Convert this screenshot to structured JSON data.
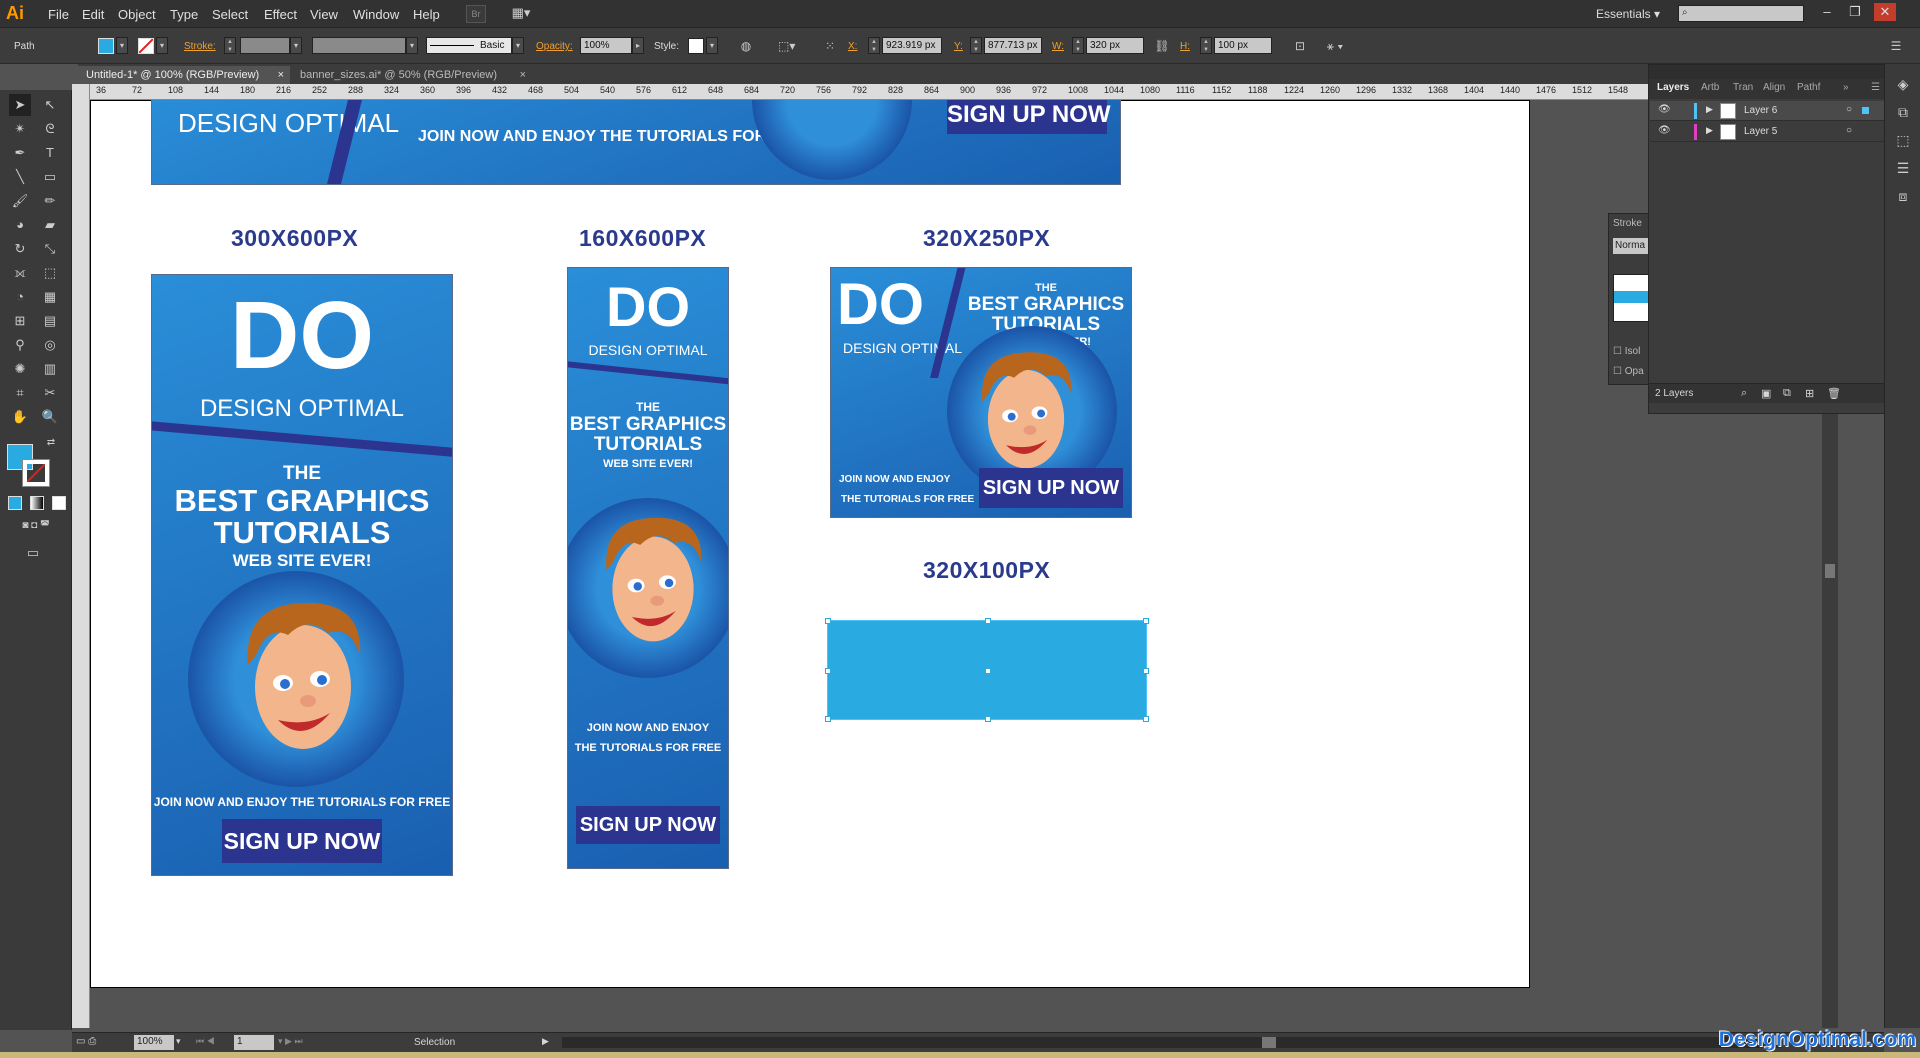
{
  "app": {
    "logo": "Ai",
    "workspace": "Essentials"
  },
  "menu": [
    "File",
    "Edit",
    "Object",
    "Type",
    "Select",
    "Effect",
    "View",
    "Window",
    "Help"
  ],
  "control": {
    "selection_type": "Path",
    "stroke_label": "Stroke:",
    "stroke_style": "Basic",
    "opacity_label": "Opacity:",
    "opacity_value": "100%",
    "style_label": "Style:",
    "x_label": "X:",
    "x_value": "923.919 px",
    "y_label": "Y:",
    "y_value": "877.713 px",
    "w_label": "W:",
    "w_value": "320 px",
    "h_label": "H:",
    "h_value": "100 px",
    "fill_color": "#29abe2"
  },
  "tabs": [
    {
      "label": "Untitled-1* @ 100% (RGB/Preview)",
      "active": true
    },
    {
      "label": "banner_sizes.ai* @ 50% (RGB/Preview)",
      "active": false
    }
  ],
  "ruler_ticks": [
    "36",
    "72",
    "108",
    "144",
    "180",
    "216",
    "252",
    "288",
    "324",
    "360",
    "396",
    "432",
    "468",
    "504",
    "540",
    "576",
    "612",
    "648",
    "684",
    "720",
    "756",
    "792",
    "828",
    "864",
    "900",
    "936",
    "972",
    "1008",
    "1044",
    "1080",
    "1116",
    "1152",
    "1188",
    "1224",
    "1260",
    "1296",
    "1332",
    "1368",
    "1404",
    "1440",
    "1476",
    "1512",
    "1548"
  ],
  "canvas": {
    "sizes": {
      "s300x600": "300X600PX",
      "s160x600": "160X600PX",
      "s320x250": "320X250PX",
      "s320x100": "320X100PX"
    },
    "banner": {
      "logo_big": "DO",
      "logo_sub": "DESIGN OPTIMAL",
      "the": "THE",
      "best": "BEST GRAPHICS",
      "tutorials": "TUTORIALS",
      "website": "WEB SITE EVER!",
      "join_full": "JOIN NOW AND ENJOY THE TUTORIALS FOR FREE",
      "join_line1": "JOIN NOW AND ENJOY",
      "join_line2": "THE TUTORIALS FOR FREE",
      "signup": "SIGN UP NOW"
    },
    "selected_rect_color": "#29abe2"
  },
  "panels": {
    "tabs": [
      "Layers",
      "Artb",
      "Tran",
      "Align",
      "Pathf"
    ],
    "layers": [
      "Layer 6",
      "Layer 5"
    ],
    "layers_count": "2 Layers",
    "stroke_panel": {
      "title": "Stroke",
      "blend": "Norma",
      "isolate": "Isol",
      "opacity": "Opa"
    }
  },
  "status": {
    "zoom": "100%",
    "artboard": "1",
    "tool": "Selection"
  },
  "watermark": "DesignOptimal.com"
}
